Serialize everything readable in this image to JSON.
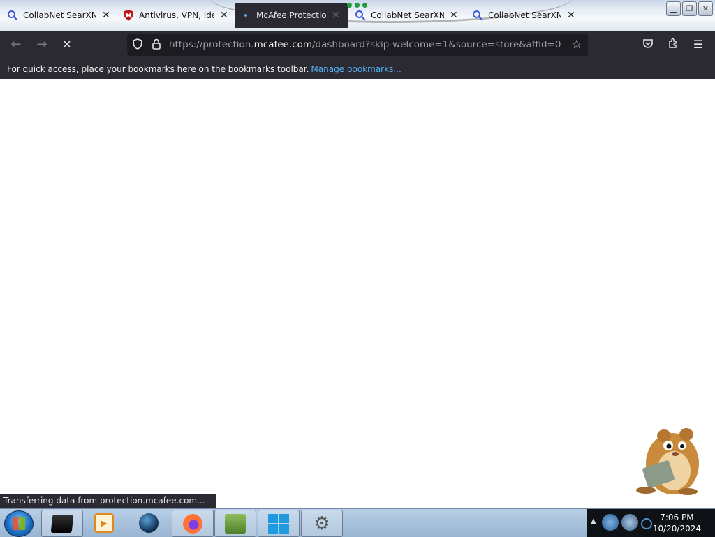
{
  "tabs": [
    {
      "label": "CollabNet SearXNG",
      "icon": "search-icon",
      "active": false
    },
    {
      "label": "Antivirus, VPN, Ident",
      "icon": "mcafee-shield-icon",
      "active": false
    },
    {
      "label": "McAfee Protection",
      "icon": "loading-dot-icon",
      "active": true
    },
    {
      "label": "CollabNet SearXNG",
      "icon": "search-icon",
      "active": false
    },
    {
      "label": "CollabNet SearXNG",
      "icon": "search-icon",
      "active": false
    }
  ],
  "navbar": {
    "url_prefix": "https://protection.",
    "url_domain": "mcafee.com",
    "url_suffix": "/dashboard?skip-welcome=1&source=store&affid=0"
  },
  "bookmarks": {
    "message": "For quick access, place your bookmarks here on the bookmarks toolbar.",
    "link": "Manage bookmarks..."
  },
  "status": {
    "text": "Transferring data from protection.mcafee.com..."
  },
  "clock": {
    "time": "7:06 PM",
    "date": "10/20/2024"
  },
  "colors": {
    "toolbar": "#2b2a33",
    "link": "#57b3f5",
    "taskbar": "#a8c2dc"
  }
}
